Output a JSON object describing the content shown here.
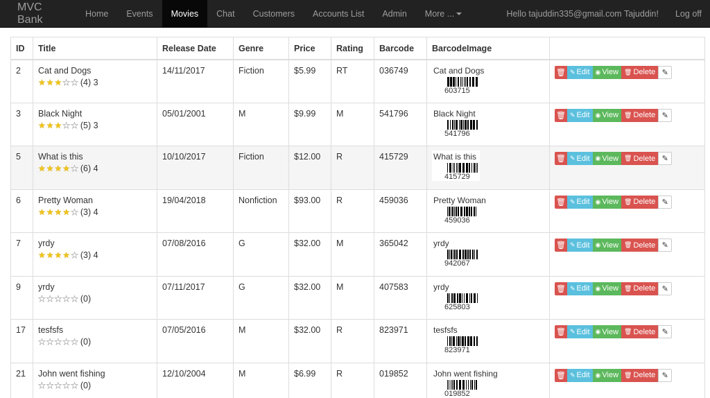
{
  "navbar": {
    "brand": "MVC Bank",
    "items": [
      {
        "label": "Home",
        "active": false
      },
      {
        "label": "Events",
        "active": false
      },
      {
        "label": "Movies",
        "active": true
      },
      {
        "label": "Chat",
        "active": false
      },
      {
        "label": "Customers",
        "active": false
      },
      {
        "label": "Accounts List",
        "active": false
      },
      {
        "label": "Admin",
        "active": false
      },
      {
        "label": "More ...",
        "active": false
      }
    ],
    "greeting": "Hello tajuddin335@gmail.com Tajuddin!",
    "logoff": "Log off"
  },
  "table": {
    "headers": [
      "ID",
      "Title",
      "Release Date",
      "Genre",
      "Price",
      "Rating",
      "Barcode",
      "BarcodeImage",
      ""
    ],
    "action_labels": {
      "edit": "Edit",
      "view": "View",
      "delete": "Delete"
    },
    "rows": [
      {
        "id": "2",
        "title": "Cat and Dogs",
        "stars": 3,
        "votes": "(4) 3",
        "release": "14/11/2017",
        "genre": "Fiction",
        "price": "$5.99",
        "rating": "RT",
        "barcode": "036749",
        "bc_label": "Cat and Dogs",
        "bc_num": "603715",
        "hover": false
      },
      {
        "id": "3",
        "title": "Black Night",
        "stars": 3,
        "votes": "(5) 3",
        "release": "05/01/2001",
        "genre": "M",
        "price": "$9.99",
        "rating": "M",
        "barcode": "541796",
        "bc_label": "Black Night",
        "bc_num": "541796",
        "hover": false
      },
      {
        "id": "5",
        "title": "What is this",
        "stars": 4,
        "votes": "(6) 4",
        "release": "10/10/2017",
        "genre": "Fiction",
        "price": "$12.00",
        "rating": "R",
        "barcode": "415729",
        "bc_label": "What is this",
        "bc_num": "415729",
        "hover": true
      },
      {
        "id": "6",
        "title": "Pretty Woman",
        "stars": 4,
        "votes": "(3) 4",
        "release": "19/04/2018",
        "genre": "Nonfiction",
        "price": "$93.00",
        "rating": "R",
        "barcode": "459036",
        "bc_label": "Pretty Woman",
        "bc_num": "459036",
        "hover": false
      },
      {
        "id": "7",
        "title": "yrdy",
        "stars": 4,
        "votes": "(3) 4",
        "release": "07/08/2016",
        "genre": "G",
        "price": "$32.00",
        "rating": "M",
        "barcode": "365042",
        "bc_label": "yrdy",
        "bc_num": "942067",
        "hover": false
      },
      {
        "id": "9",
        "title": "yrdy",
        "stars": 0,
        "votes": "(0)",
        "release": "07/11/2017",
        "genre": "G",
        "price": "$32.00",
        "rating": "M",
        "barcode": "407583",
        "bc_label": "yrdy",
        "bc_num": "625803",
        "hover": false
      },
      {
        "id": "17",
        "title": "tesfsfs",
        "stars": 0,
        "votes": "(0)",
        "release": "07/05/2016",
        "genre": "M",
        "price": "$32.00",
        "rating": "R",
        "barcode": "823971",
        "bc_label": "tesfsfs",
        "bc_num": "823971",
        "hover": false
      },
      {
        "id": "21",
        "title": "John went fishing",
        "stars": 0,
        "votes": "(0)",
        "release": "12/10/2004",
        "genre": "M",
        "price": "$6.99",
        "rating": "R",
        "barcode": "019852",
        "bc_label": "John went fishing",
        "bc_num": "019852",
        "hover": false
      }
    ]
  },
  "colors": {
    "navbar_bg": "#222222",
    "nav_active_bg": "#080808",
    "danger": "#d9534f",
    "info": "#5bc0de",
    "success": "#5cb85c",
    "star": "#f0c419"
  },
  "icons": {
    "trash": "trash-icon",
    "pencil": "pencil-icon",
    "eye": "eye-icon",
    "star": "star-icon",
    "caret": "caret-down-icon"
  }
}
